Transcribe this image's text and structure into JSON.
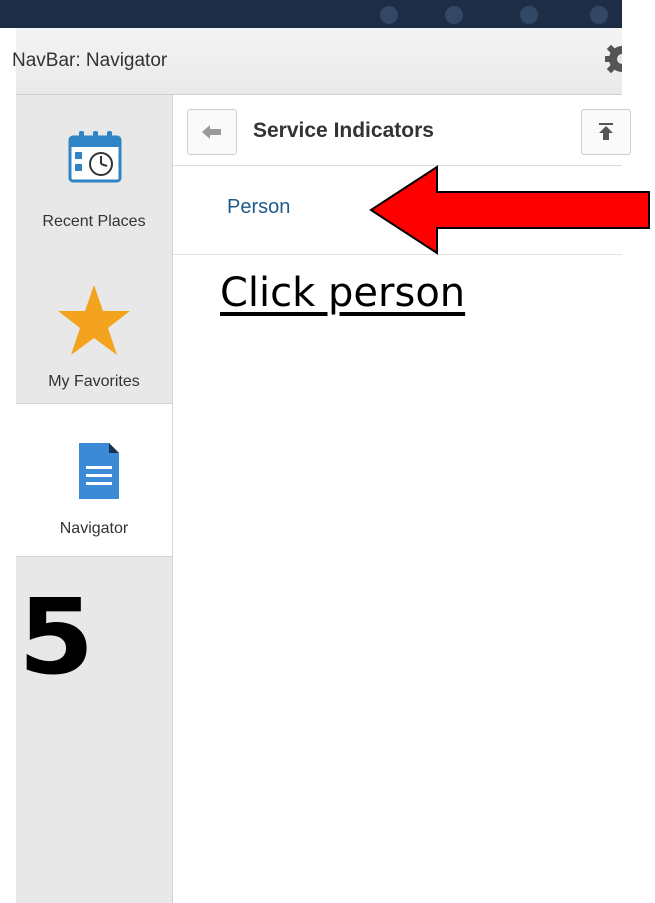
{
  "header": {
    "title": "NavBar: Navigator"
  },
  "sidebar": {
    "items": [
      {
        "label": "Recent Places",
        "icon": "calendar-clock-icon"
      },
      {
        "label": "My Favorites",
        "icon": "star-icon"
      },
      {
        "label": "Navigator",
        "icon": "document-icon"
      }
    ]
  },
  "breadcrumb": {
    "title": "Service Indicators"
  },
  "list": {
    "items": [
      {
        "label": "Person"
      }
    ]
  },
  "annotation": {
    "instruction": "Click person",
    "step_number": "5",
    "arrow_color": "#ff0000"
  }
}
